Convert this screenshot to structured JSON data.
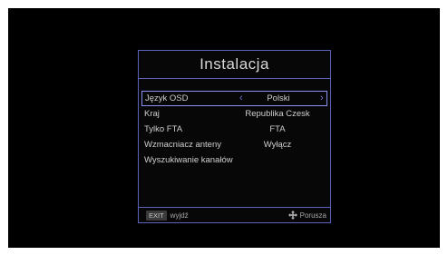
{
  "dialog": {
    "title": "Instalacja"
  },
  "menu": {
    "items": [
      {
        "label": "Język OSD",
        "value": "Polski",
        "selected": true
      },
      {
        "label": "Kraj",
        "value": "Republika Czesk"
      },
      {
        "label": "Tylko FTA",
        "value": "FTA"
      },
      {
        "label": "Wzmacniacz anteny",
        "value": "Wyłącz"
      },
      {
        "label": "Wyszukiwanie kanałów",
        "value": ""
      }
    ],
    "arrow_left": "‹",
    "arrow_right": "›"
  },
  "footer": {
    "exit_key": "EXIT",
    "exit_text": "wyjdź",
    "move_text": "Porusza",
    "move_icon": "four-arrow-move-icon"
  },
  "colors": {
    "accent": "#5c62b8",
    "selection": "#8a8ff0"
  }
}
